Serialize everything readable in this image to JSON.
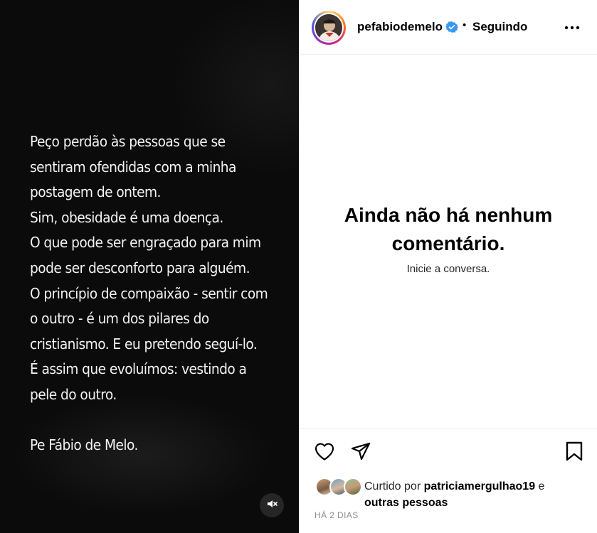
{
  "post": {
    "story_text": "Peço perdão às pessoas que se\nsentiram ofendidas com a minha\npostagem de ontem.\nSim, obesidade é uma doença.\nO que pode ser engraçado para mim\npode ser desconforto  para alguém.\nO princípio de compaixão - sentir com\no outro - é um dos pilares do\ncristianismo. E eu pretendo seguí-lo.\nÉ assim que evoluímos: vestindo a\npele do outro.\n\nPe Fábio de Melo."
  },
  "header": {
    "username": "pefabiodemelo",
    "separator": "•",
    "follow_status": "Seguindo"
  },
  "comments": {
    "empty_title": "Ainda não há nenhum comentário.",
    "empty_subtitle": "Inicie a conversa."
  },
  "likes": {
    "prefix": "Curtido por ",
    "user": "patriciamergulhao19",
    "connector": " e ",
    "others": "outras pessoas"
  },
  "timestamp": "HÁ 2 DIAS",
  "icons": {
    "verified": "verified-badge-icon",
    "more": "more-options-icon",
    "like": "heart-icon",
    "share": "paper-plane-icon",
    "save": "bookmark-icon",
    "mute": "muted-speaker-icon"
  },
  "colors": {
    "verified_blue": "#3897f0",
    "media_background": "#0b0b0b",
    "muted_text": "#8e8e8e"
  }
}
